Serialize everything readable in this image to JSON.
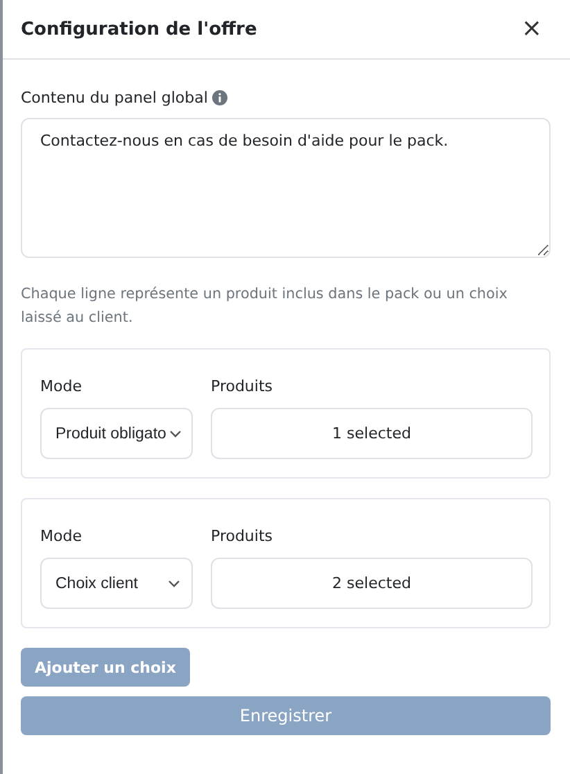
{
  "dialog": {
    "title": "Configuration de l'offre",
    "close": "×"
  },
  "global_panel": {
    "label": "Contenu du panel global",
    "value": "Contactez-nous en cas de besoin d'aide pour le pack."
  },
  "help_text": "Chaque ligne représente un produit inclus dans le pack ou un choix laissé au client.",
  "choices": [
    {
      "mode_label": "Mode",
      "mode_value": "Produit obligato",
      "products_label": "Produits",
      "products_value": "1 selected"
    },
    {
      "mode_label": "Mode",
      "mode_value": "Choix client",
      "products_label": "Produits",
      "products_value": "2 selected"
    }
  ],
  "add_button": {
    "label": "Ajouter un choix",
    "disabled": true
  },
  "save_button": {
    "label": "Enregistrer",
    "disabled": true
  }
}
